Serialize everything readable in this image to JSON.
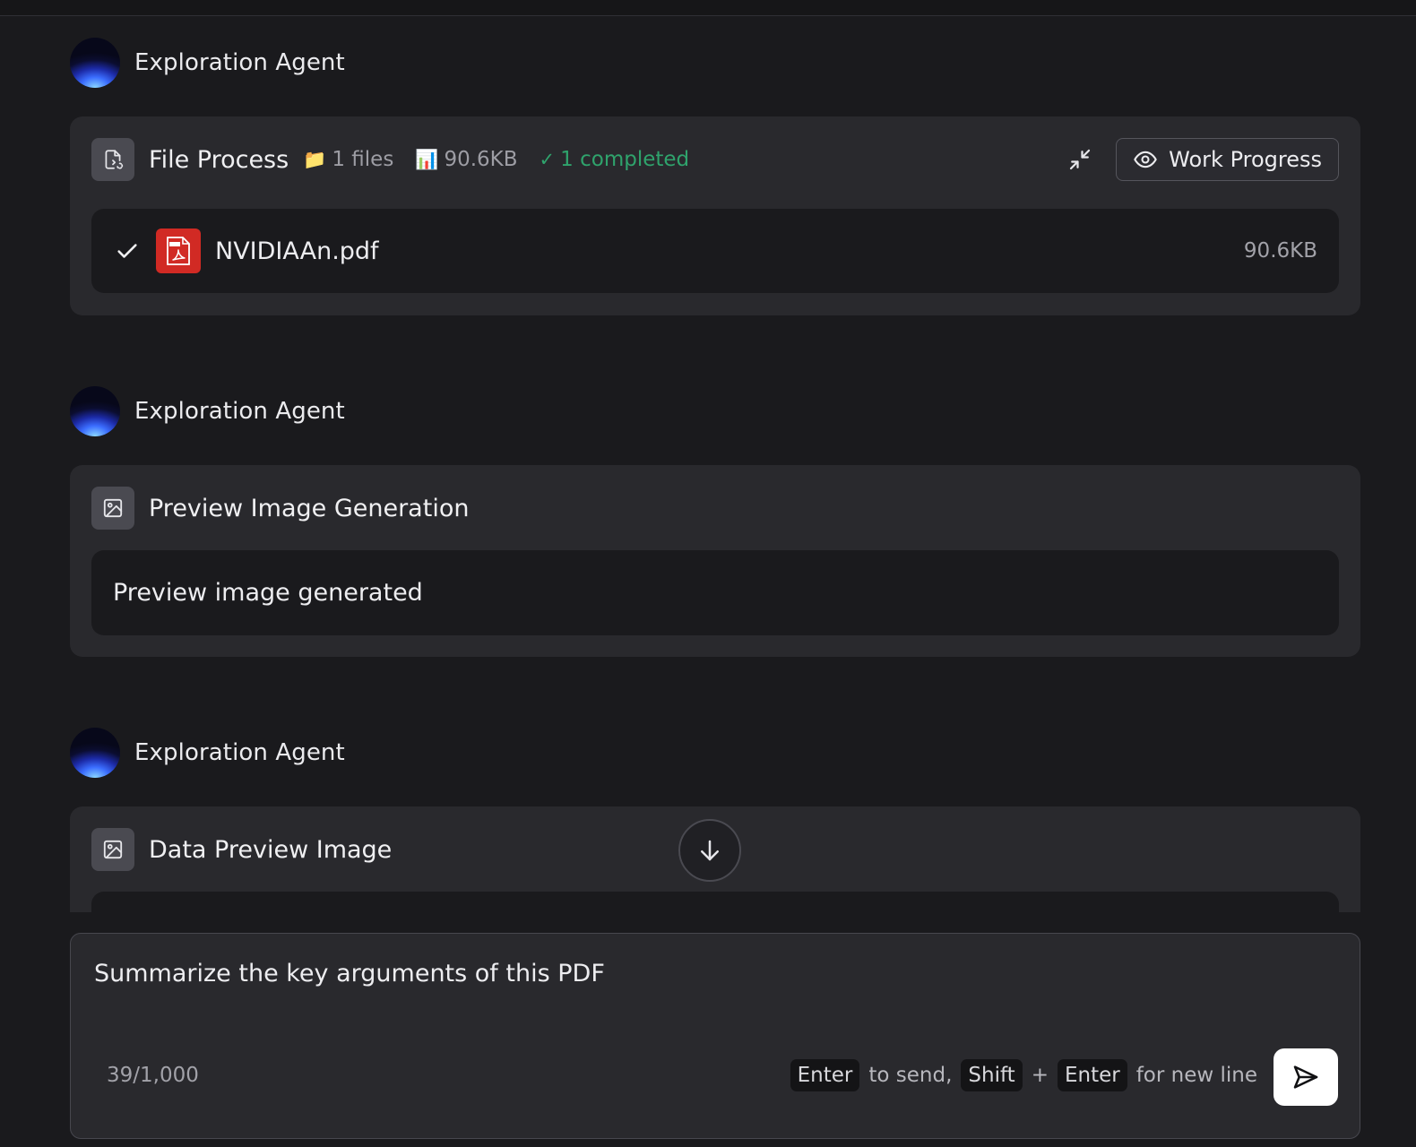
{
  "agent_name": "Exploration Agent",
  "file_process": {
    "title": "File Process",
    "files_icon": "folder-icon",
    "files_glyph": "📁",
    "files_count": "1 files",
    "size_icon": "bar-chart-icon",
    "size_glyph": "📊",
    "size": "90.6KB",
    "completed_glyph": "✓",
    "completed": "1 completed",
    "work_progress_label": "Work Progress",
    "file": {
      "name": "NVIDIAAn.pdf",
      "size": "90.6KB",
      "status": "completed"
    }
  },
  "preview_generation": {
    "title": "Preview Image Generation",
    "message": "Preview image generated"
  },
  "data_preview": {
    "title": "Data Preview Image"
  },
  "composer": {
    "value": "Summarize the key arguments of this PDF",
    "char_count": "39/1,000",
    "hint": {
      "key_enter": "Enter",
      "to_send": "to send,",
      "key_shift": "Shift",
      "plus": "+",
      "key_enter2": "Enter",
      "new_line": "for new line"
    }
  },
  "colors": {
    "background": "#1a1a1d",
    "card": "#29292d",
    "success": "#2fa36c",
    "pdf": "#d12a24",
    "send_button": "#ffffff"
  }
}
